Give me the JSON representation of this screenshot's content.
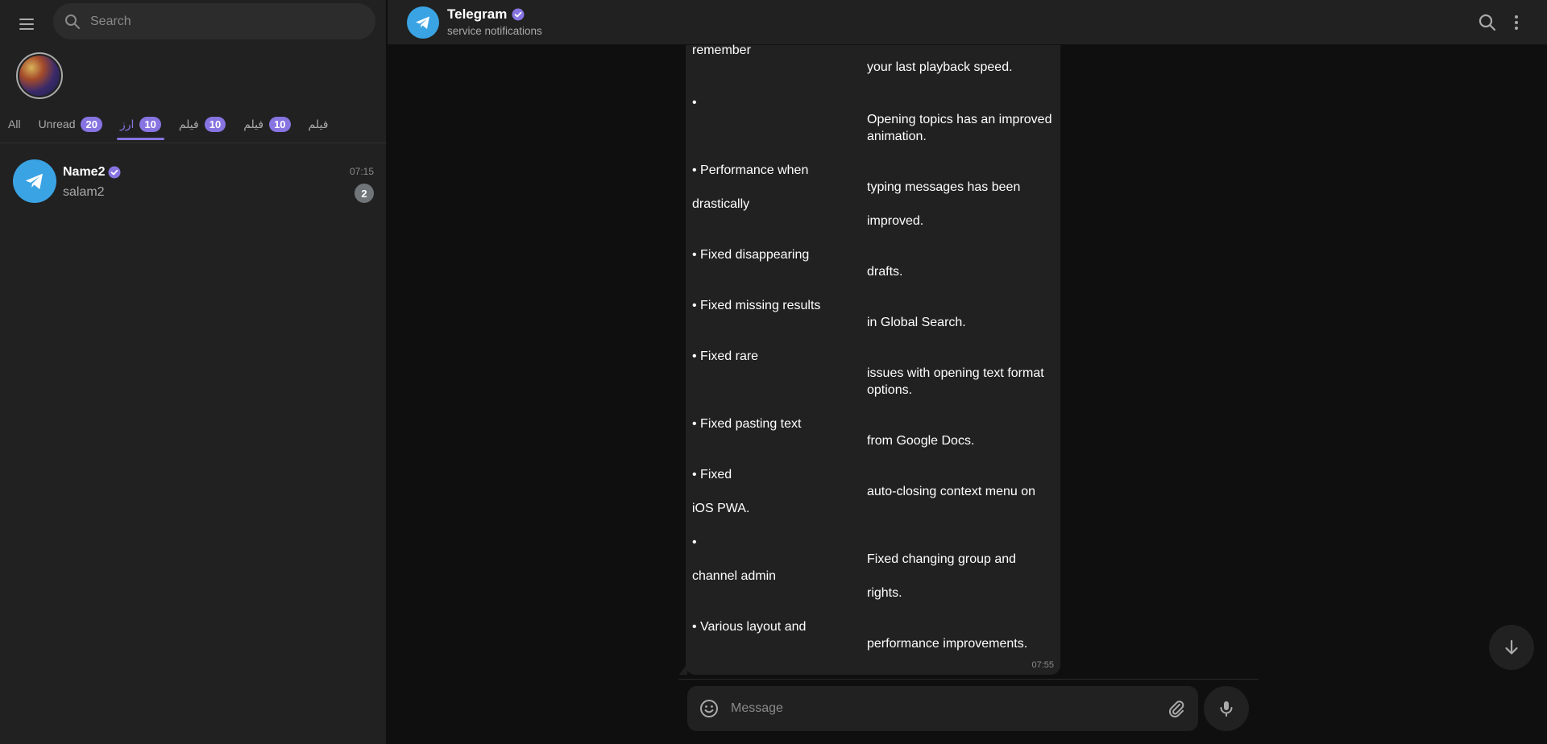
{
  "sidebar": {
    "search_placeholder": "Search",
    "tabs": [
      {
        "label": "All",
        "count": ""
      },
      {
        "label": "Unread",
        "count": "20"
      },
      {
        "label": "ارز",
        "count": "10"
      },
      {
        "label": "فیلم",
        "count": "10"
      },
      {
        "label": "فیلم",
        "count": "10"
      },
      {
        "label": "فیلم",
        "count": ""
      }
    ],
    "active_tab": "ارز",
    "chats": [
      {
        "name": "Name2",
        "time": "07:15",
        "preview": "salam2",
        "unread": "2",
        "verified": true
      }
    ]
  },
  "header": {
    "title": "Telegram",
    "subtitle": "service notifications"
  },
  "message": {
    "lines": [
      "remember",
      "your last playback speed.",
      "•",
      "Opening topics has an improved",
      "animation.",
      "• Performance when",
      "typing messages has been",
      "drastically",
      "improved.",
      "• Fixed disappearing",
      "drafts.",
      "• Fixed missing results",
      "in Global Search.",
      "• Fixed rare",
      "issues with opening text format",
      "options.",
      "• Fixed pasting text",
      "from Google Docs.",
      "• Fixed",
      "auto-closing context menu on",
      "iOS PWA.",
      "•",
      "Fixed changing group and",
      "channel admin",
      "rights.",
      "• Various layout and",
      "performance improvements."
    ],
    "time": "07:55"
  },
  "composer": {
    "placeholder": "Message"
  },
  "colors": {
    "accent": "#8774e1",
    "telegram_blue": "#3aa3e3",
    "panel": "#212121",
    "background": "#0f0f0f"
  },
  "icons": [
    "menu-icon",
    "search-icon",
    "verified-icon",
    "telegram-plane-icon",
    "more-vertical-icon",
    "emoji-icon",
    "attach-icon",
    "microphone-icon",
    "arrow-down-icon"
  ]
}
